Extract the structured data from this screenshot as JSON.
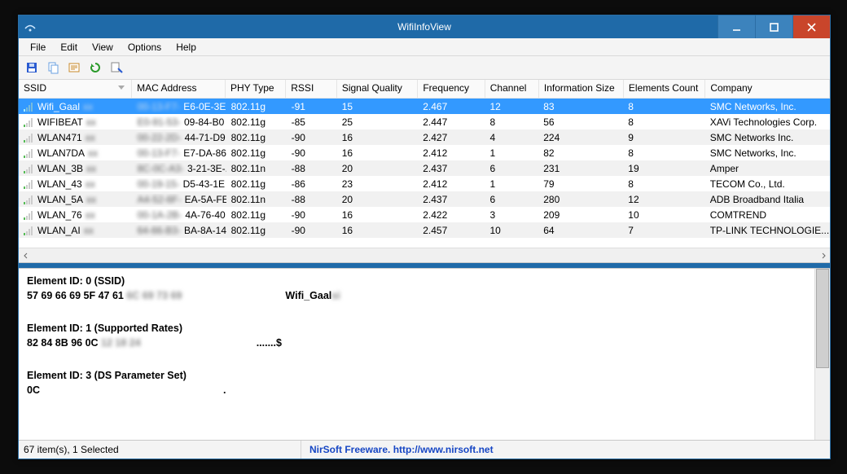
{
  "window": {
    "title": "WifiInfoView"
  },
  "menu": {
    "file": "File",
    "edit": "Edit",
    "view": "View",
    "options": "Options",
    "help": "Help"
  },
  "columns": {
    "ssid": "SSID",
    "mac": "MAC Address",
    "phy": "PHY Type",
    "rssi": "RSSI",
    "sig": "Signal Quality",
    "freq": "Frequency",
    "chan": "Channel",
    "info": "Information Size",
    "elem": "Elements Count",
    "comp": "Company"
  },
  "rows": [
    {
      "ssid": "Wifi_Gaal",
      "mac_blur": "00-13-F7-",
      "mac": "E6-0E-3E",
      "phy": "802.11g",
      "rssi": "-91",
      "sig": "15",
      "freq": "2.467",
      "chan": "12",
      "info": "83",
      "elem": "8",
      "comp": "SMC Networks, Inc.",
      "selected": true
    },
    {
      "ssid": "WIFIBEAT",
      "mac_blur": "E0-91-53-",
      "mac": "09-84-B0",
      "phy": "802.11g",
      "rssi": "-85",
      "sig": "25",
      "freq": "2.447",
      "chan": "8",
      "info": "56",
      "elem": "8",
      "comp": "XAVi Technologies Corp."
    },
    {
      "ssid": "WLAN471",
      "mac_blur": "00-22-2D-",
      "mac": "44-71-D9",
      "phy": "802.11g",
      "rssi": "-90",
      "sig": "16",
      "freq": "2.427",
      "chan": "4",
      "info": "224",
      "elem": "9",
      "comp": "SMC Networks Inc."
    },
    {
      "ssid": "WLAN7DA",
      "mac_blur": "00-13-F7-",
      "mac": "E7-DA-86",
      "phy": "802.11g",
      "rssi": "-90",
      "sig": "16",
      "freq": "2.412",
      "chan": "1",
      "info": "82",
      "elem": "8",
      "comp": "SMC Networks, Inc."
    },
    {
      "ssid": "WLAN_3B",
      "mac_blur": "8C-0C-A3-",
      "mac": "3-21-3E-...",
      "phy": "802.11n",
      "rssi": "-88",
      "sig": "20",
      "freq": "2.437",
      "chan": "6",
      "info": "231",
      "elem": "19",
      "comp": "Amper"
    },
    {
      "ssid": "WLAN_43",
      "mac_blur": "00-19-15-",
      "mac": "D5-43-1E",
      "phy": "802.11g",
      "rssi": "-86",
      "sig": "23",
      "freq": "2.412",
      "chan": "1",
      "info": "79",
      "elem": "8",
      "comp": "TECOM Co., Ltd."
    },
    {
      "ssid": "WLAN_5A",
      "mac_blur": "A4-52-6F-",
      "mac": "EA-5A-FE",
      "phy": "802.11n",
      "rssi": "-88",
      "sig": "20",
      "freq": "2.437",
      "chan": "6",
      "info": "280",
      "elem": "12",
      "comp": "ADB Broadband Italia"
    },
    {
      "ssid": "WLAN_76",
      "mac_blur": "00-1A-2B-",
      "mac": "4A-76-40",
      "phy": "802.11g",
      "rssi": "-90",
      "sig": "16",
      "freq": "2.422",
      "chan": "3",
      "info": "209",
      "elem": "10",
      "comp": "COMTREND"
    },
    {
      "ssid": "WLAN_AI",
      "mac_blur": "64-66-B3-",
      "mac": "BA-8A-14",
      "phy": "802.11g",
      "rssi": "-90",
      "sig": "16",
      "freq": "2.457",
      "chan": "10",
      "info": "64",
      "elem": "7",
      "comp": "TP-LINK TECHNOLOGIE..."
    }
  ],
  "detail": {
    "e0_title": "Element ID: 0  (SSID)",
    "e0_hex": "57 69 66 69 5F 47 61",
    "e0_hex_blur": "6C 69 73 69",
    "e0_text": "Wifi_Gaal",
    "e0_text_blur": "si",
    "e1_title": "Element ID: 1  (Supported Rates)",
    "e1_hex": "82 84 8B 96 0C",
    "e1_hex_blur": "12 18 24",
    "e1_text": ".......$",
    "e3_title": "Element ID: 3  (DS Parameter Set)",
    "e3_hex": "0C",
    "e3_dot": "."
  },
  "status": {
    "count": "67 item(s), 1 Selected",
    "credit": "NirSoft Freeware.  http://www.nirsoft.net"
  }
}
